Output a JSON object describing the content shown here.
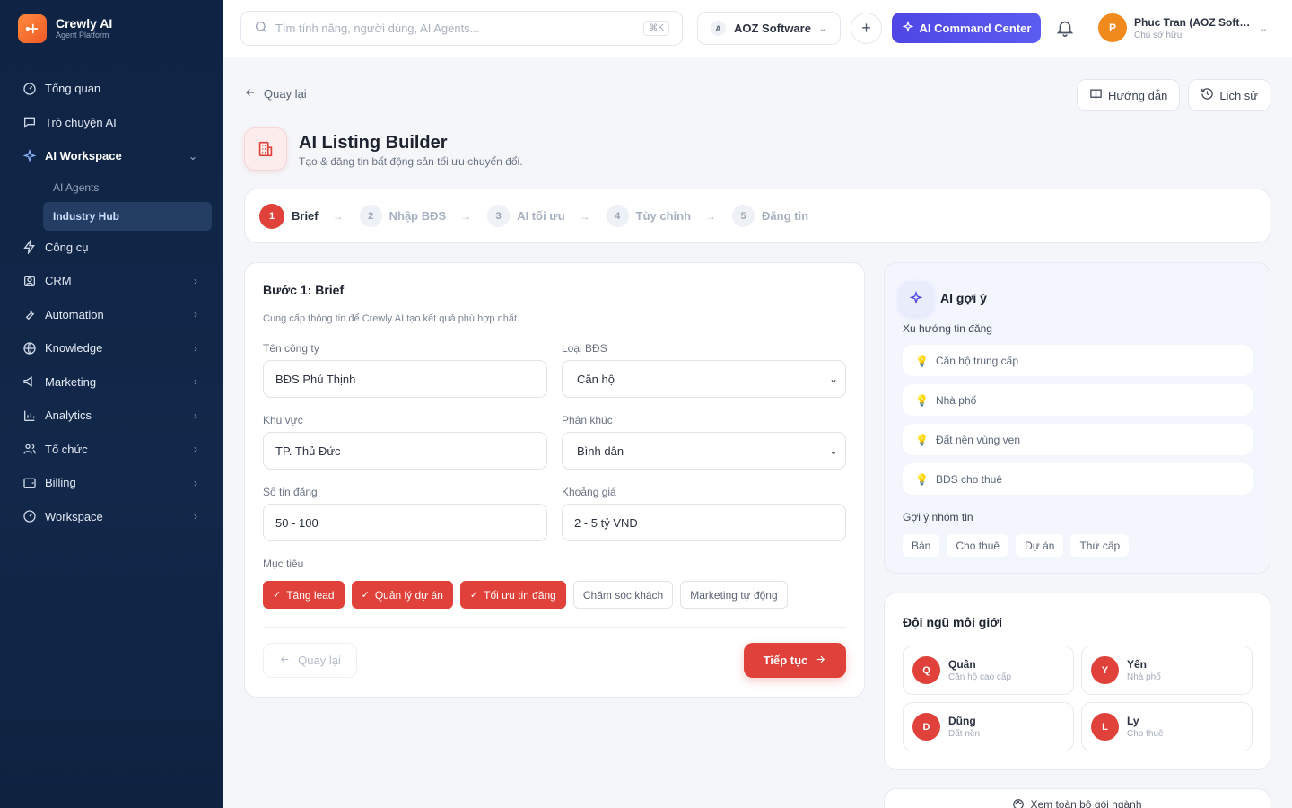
{
  "brand": {
    "name": "Crewly AI",
    "tagline": "Agent Platform"
  },
  "nav": {
    "items": [
      {
        "label": "Tổng quan",
        "icon": "gauge-icon"
      },
      {
        "label": "Trò chuyện AI",
        "icon": "chat-icon"
      },
      {
        "label": "AI Workspace",
        "icon": "sparkle-icon"
      },
      {
        "label": "Công cụ",
        "icon": "bolt-icon"
      },
      {
        "label": "CRM",
        "icon": "contact-icon"
      },
      {
        "label": "Automation",
        "icon": "wrench-icon"
      },
      {
        "label": "Knowledge",
        "icon": "globe-icon"
      },
      {
        "label": "Marketing",
        "icon": "megaphone-icon"
      },
      {
        "label": "Analytics",
        "icon": "bar-chart-icon"
      },
      {
        "label": "Tổ chức",
        "icon": "users-icon"
      },
      {
        "label": "Billing",
        "icon": "wallet-icon"
      },
      {
        "label": "Workspace",
        "icon": "gauge-icon"
      }
    ],
    "sub_items": [
      {
        "label": "AI Agents"
      },
      {
        "label": "Industry Hub"
      }
    ]
  },
  "topbar": {
    "search_placeholder": "Tìm tính năng, người dùng, AI Agents...",
    "search_shortcut": "⌘K",
    "workspace_badge": "A",
    "workspace_name": "AOZ Software",
    "command_label": "AI Command Center",
    "user_initial": "P",
    "user_name": "Phuc Tran (AOZ Software)",
    "user_role": "Chủ sở hữu"
  },
  "page": {
    "back_label": "Quay lại",
    "guide_label": "Hướng dẫn",
    "history_label": "Lịch sử",
    "title": "AI Listing Builder",
    "subtitle": "Tạo & đăng tin bất động sản tối ưu chuyển đổi."
  },
  "steps": [
    {
      "num": "1",
      "label": "Brief"
    },
    {
      "num": "2",
      "label": "Nhập BĐS"
    },
    {
      "num": "3",
      "label": "AI tối ưu"
    },
    {
      "num": "4",
      "label": "Tùy chỉnh"
    },
    {
      "num": "5",
      "label": "Đăng tin"
    }
  ],
  "form": {
    "title": "Bước 1: Brief",
    "description": "Cung cấp thông tin để Crewly AI tạo kết quả phù hợp nhất.",
    "company": {
      "label": "Tên công ty",
      "value": "BĐS Phú Thịnh"
    },
    "property_type": {
      "label": "Loại BĐS",
      "value": "Căn hộ"
    },
    "area": {
      "label": "Khu vực",
      "value": "TP. Thủ Đức"
    },
    "segment": {
      "label": "Phân khúc",
      "value": "Bình dân"
    },
    "listing_count": {
      "label": "Số tin đăng",
      "value": "50 - 100"
    },
    "price_range": {
      "label": "Khoảng giá",
      "value": "2 - 5 tỷ VND"
    },
    "goals_label": "Mục tiêu",
    "goals": [
      {
        "label": "Tăng lead",
        "selected": true
      },
      {
        "label": "Quản lý dự án",
        "selected": true
      },
      {
        "label": "Tối ưu tin đăng",
        "selected": true
      },
      {
        "label": "Chăm sóc khách",
        "selected": false
      },
      {
        "label": "Marketing tự động",
        "selected": false
      }
    ],
    "back_label": "Quay lại",
    "next_label": "Tiếp tục"
  },
  "ai_suggest": {
    "title": "AI gợi ý",
    "trends_label": "Xu hướng tin đăng",
    "trends": [
      "Căn hộ trung cấp",
      "Nhà phố",
      "Đất nền vùng ven",
      "BĐS cho thuê"
    ],
    "groups_label": "Gợi ý nhóm tin",
    "groups": [
      "Bán",
      "Cho thuê",
      "Dự án",
      "Thứ cấp"
    ]
  },
  "team": {
    "title": "Đội ngũ môi giới",
    "agents": [
      {
        "initial": "Q",
        "name": "Quân",
        "spec": "Căn hộ cao cấp"
      },
      {
        "initial": "Y",
        "name": "Yến",
        "spec": "Nhà phố"
      },
      {
        "initial": "D",
        "name": "Dũng",
        "spec": "Đất nền"
      },
      {
        "initial": "L",
        "name": "Ly",
        "spec": "Cho thuê"
      }
    ]
  },
  "more_label": "Xem toàn bộ gói ngành",
  "colors": {
    "accent": "#e0413a",
    "primary": "#4f46e5",
    "sidebar": "#0f2444"
  }
}
